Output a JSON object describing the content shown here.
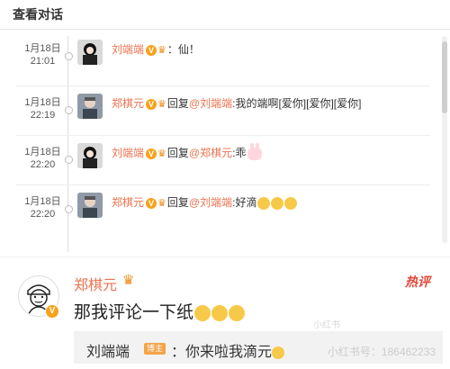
{
  "header": {
    "title": "查看对话"
  },
  "thread": [
    {
      "date": "1月18日",
      "time": "21:01",
      "author": "刘端端",
      "reply_word": "",
      "mention": "",
      "separator": "：",
      "text": "仙！",
      "emoji": []
    },
    {
      "date": "1月18日",
      "time": "22:19",
      "author": "郑棋元",
      "reply_word": "回复",
      "mention": "@刘端端",
      "separator": ":",
      "text": "我的端啊[爱你][爱你][爱你]",
      "emoji": []
    },
    {
      "date": "1月18日",
      "time": "22:20",
      "author": "刘端端",
      "reply_word": "回复",
      "mention": "@郑棋元",
      "separator": ":",
      "text": "乖",
      "emoji": [
        "bunny"
      ]
    },
    {
      "date": "1月18日",
      "time": "22:20",
      "author": "郑棋元",
      "reply_word": "回复",
      "mention": "@刘端端",
      "separator": ":",
      "text": "好滴",
      "emoji": [
        "smile",
        "smile",
        "smile"
      ]
    }
  ],
  "hot_comment": {
    "author": "郑棋元",
    "hot_label": "热评",
    "text": "那我评论一下纸",
    "avatar_badge": "V"
  },
  "reply_preview": {
    "author": "刘端端",
    "tag": "博主",
    "text": "：你来啦我滴元"
  },
  "watermark": {
    "main": "小红书号：186462233",
    "small": "小红书"
  },
  "colors": {
    "name": "#eb7350",
    "hot": "#e4473a",
    "badge": "#f7a21b"
  }
}
